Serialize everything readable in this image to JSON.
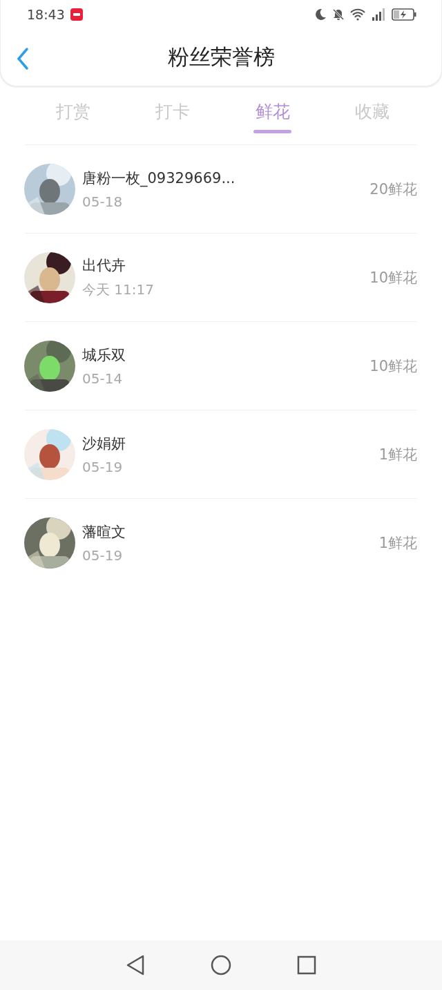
{
  "status_bar": {
    "time": "18:43"
  },
  "header": {
    "title": "粉丝荣誉榜"
  },
  "tabs": [
    {
      "label": "打赏",
      "selected": false
    },
    {
      "label": "打卡",
      "selected": false
    },
    {
      "label": "鲜花",
      "selected": true
    },
    {
      "label": "收藏",
      "selected": false
    }
  ],
  "fans": [
    {
      "name": "唐粉一枚_09329669...",
      "date": "05-18",
      "amount": "20鲜花"
    },
    {
      "name": "出代卉",
      "date": "今天 11:17",
      "amount": "10鲜花"
    },
    {
      "name": "城乐双",
      "date": "05-14",
      "amount": "10鲜花"
    },
    {
      "name": "沙娟妍",
      "date": "05-19",
      "amount": "1鲜花"
    },
    {
      "name": "藩暄文",
      "date": "05-19",
      "amount": "1鲜花"
    }
  ]
}
